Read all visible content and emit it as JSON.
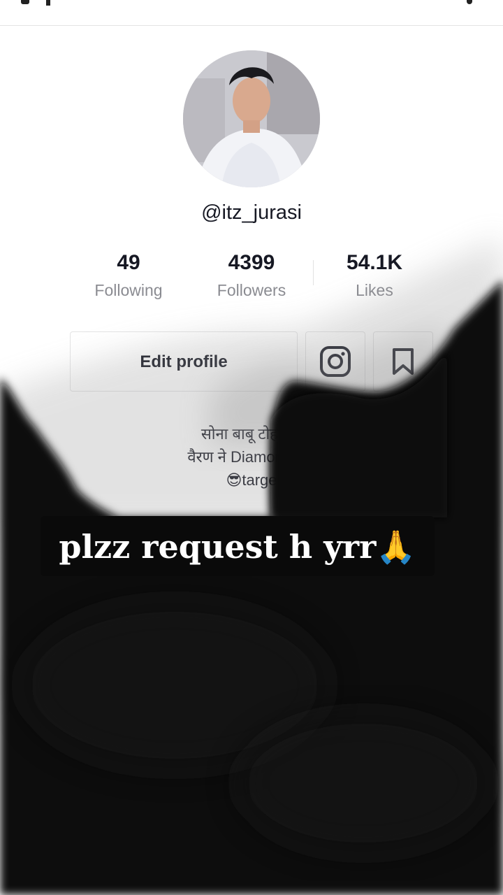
{
  "profile": {
    "username": "@itz_jurasi",
    "avatar_icon": "profile-photo"
  },
  "stats": {
    "following": {
      "value": "49",
      "label": "Following"
    },
    "followers": {
      "value": "4399",
      "label": "Followers"
    },
    "likes": {
      "value": "54.1K",
      "label": "Likes"
    }
  },
  "actions": {
    "edit_profile_label": "Edit profile",
    "instagram_icon": "instagram-icon",
    "bookmark_icon": "bookmark-icon"
  },
  "bio": {
    "line1": "सोना बाबू टोहण वे",
    "line2": "वैरण ने Diamond यार",
    "line3": "😎targe"
  },
  "overlay": {
    "caption": "plzz request h yrr🙏"
  },
  "colors": {
    "text_primary": "#161823",
    "text_secondary": "#8a8b91",
    "overlay_black": "#0b0b0b"
  }
}
